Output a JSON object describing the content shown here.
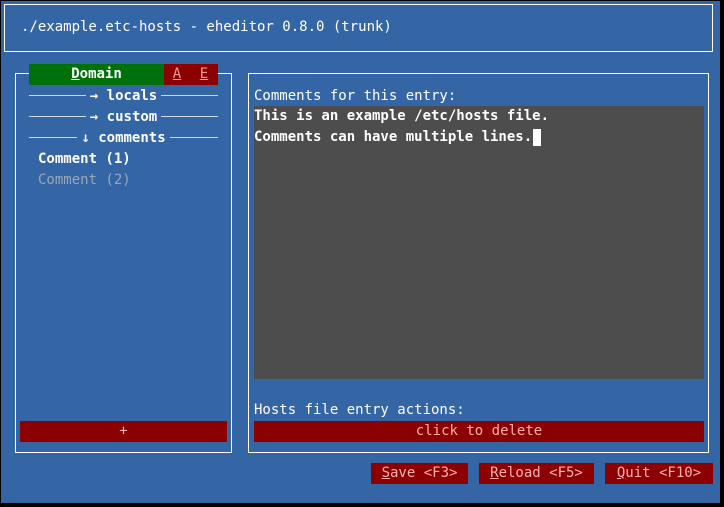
{
  "window": {
    "title": "./example.etc-hosts - eheditor 0.8.0 (trunk)"
  },
  "tabs": {
    "domain": {
      "first": "D",
      "rest": "omain"
    },
    "a": "A",
    "e": "E"
  },
  "tree": [
    {
      "arrow": "→",
      "label": "locals"
    },
    {
      "arrow": "→",
      "label": "custom"
    },
    {
      "arrow": "↓",
      "label": "comments"
    }
  ],
  "list": [
    {
      "label": "Comment (1)",
      "selected": true
    },
    {
      "label": "Comment (2)",
      "selected": false
    }
  ],
  "add_button": "+",
  "editor": {
    "label": "Comments for this entry:",
    "lines": [
      "This is an example /etc/hosts file.",
      "Comments can have multiple lines."
    ]
  },
  "actions": {
    "label": "Hosts file entry actions:",
    "delete_label": "click to delete"
  },
  "footer": {
    "save": {
      "first": "S",
      "rest": "ave <F3>"
    },
    "reload": {
      "first": "R",
      "rest": "eload <F5>"
    },
    "quit": {
      "first": "Q",
      "rest": "uit <F10>"
    }
  },
  "colors": {
    "terminal_bg": "#3465a4",
    "active_tab": "#00700a",
    "button_bg": "#8b0000",
    "editor_bg": "#4d4d4d"
  }
}
